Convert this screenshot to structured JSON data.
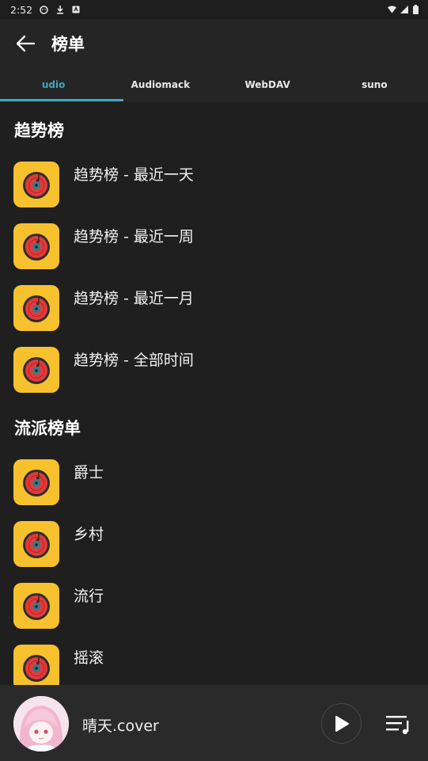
{
  "status": {
    "time": "2:52"
  },
  "header": {
    "title": "榜单",
    "back_icon": "arrow-left-icon"
  },
  "tabs": [
    {
      "label": "udio",
      "active": true
    },
    {
      "label": "Audiomack",
      "active": false
    },
    {
      "label": "WebDAV",
      "active": false
    },
    {
      "label": "suno",
      "active": false
    }
  ],
  "sections": [
    {
      "title": "趋势榜",
      "items": [
        "趋势榜 - 最近一天",
        "趋势榜 - 最近一周",
        "趋势榜 - 最近一月",
        "趋势榜 - 全部时间"
      ]
    },
    {
      "title": "流派榜单",
      "items": [
        "爵士",
        "乡村",
        "流行",
        "摇滚"
      ]
    }
  ],
  "player": {
    "track_title": "晴天.cover",
    "play_icon": "play-icon",
    "queue_icon": "playlist-icon"
  },
  "colors": {
    "accent": "#3fa7bf",
    "thumb_bg": "#f7c12e",
    "disc_red": "#e33a3a"
  }
}
